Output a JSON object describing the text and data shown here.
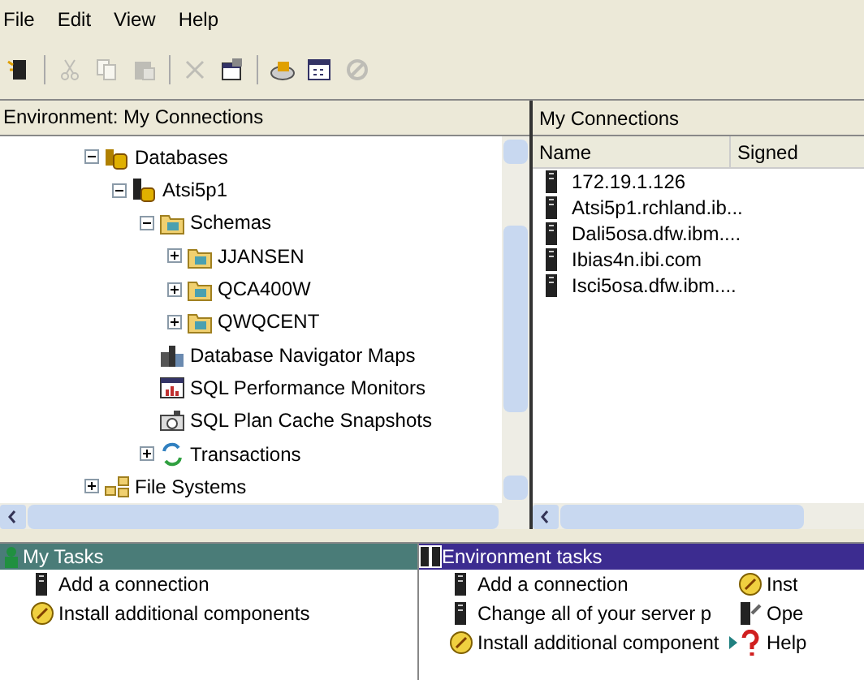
{
  "menu": [
    "File",
    "Edit",
    "View",
    "Help"
  ],
  "toolbar": [
    {
      "kind": "new",
      "disabled": false
    },
    {
      "kind": "sep"
    },
    {
      "kind": "cut",
      "disabled": true
    },
    {
      "kind": "copy",
      "disabled": true
    },
    {
      "kind": "paste",
      "disabled": true
    },
    {
      "kind": "sep"
    },
    {
      "kind": "delete",
      "disabled": true
    },
    {
      "kind": "properties",
      "disabled": false
    },
    {
      "kind": "sep"
    },
    {
      "kind": "disk",
      "disabled": false
    },
    {
      "kind": "calendar",
      "disabled": false
    },
    {
      "kind": "stop",
      "disabled": true
    }
  ],
  "left_panel": {
    "title": "Environment: My Connections",
    "tree": [
      {
        "label": "Databases",
        "kind": "databases",
        "expanded": true,
        "children": [
          {
            "label": "Atsi5p1",
            "kind": "database",
            "expanded": true,
            "children": [
              {
                "label": "Schemas",
                "kind": "folder",
                "expanded": true,
                "children": [
                  {
                    "label": "JJANSEN",
                    "kind": "schema",
                    "expanded": false
                  },
                  {
                    "label": "QCA400W",
                    "kind": "schema",
                    "expanded": false
                  },
                  {
                    "label": "QWQCENT",
                    "kind": "schema",
                    "expanded": false
                  }
                ]
              },
              {
                "label": "Database Navigator Maps",
                "kind": "maps"
              },
              {
                "label": "SQL Performance Monitors",
                "kind": "monitor"
              },
              {
                "label": "SQL Plan Cache Snapshots",
                "kind": "snapshot"
              },
              {
                "label": "Transactions",
                "kind": "transactions",
                "expanded": false
              }
            ]
          }
        ]
      },
      {
        "label": "File Systems",
        "kind": "filesystems",
        "expanded": false
      }
    ]
  },
  "right_panel": {
    "title": "My Connections",
    "columns": [
      "Name",
      "Signed"
    ],
    "rows": [
      "172.19.1.126",
      "Atsi5p1.rchland.ib...",
      "Dali5osa.dfw.ibm....",
      "Ibias4n.ibi.com",
      "Isci5osa.dfw.ibm...."
    ]
  },
  "my_tasks": {
    "title": "My Tasks",
    "items": [
      {
        "label": "Add a connection",
        "kind": "server"
      },
      {
        "label": "Install additional components",
        "kind": "install"
      }
    ]
  },
  "environment_tasks": {
    "title": "Environment tasks",
    "columns": [
      [
        {
          "label": "Add a connection",
          "kind": "server"
        },
        {
          "label": "Change all of your server p",
          "kind": "server"
        },
        {
          "label": "Install additional component",
          "kind": "install",
          "submenu": true
        }
      ],
      [
        {
          "label": "Inst",
          "kind": "install"
        },
        {
          "label": "Ope",
          "kind": "operations"
        },
        {
          "label": "Help",
          "kind": "help"
        }
      ]
    ]
  }
}
